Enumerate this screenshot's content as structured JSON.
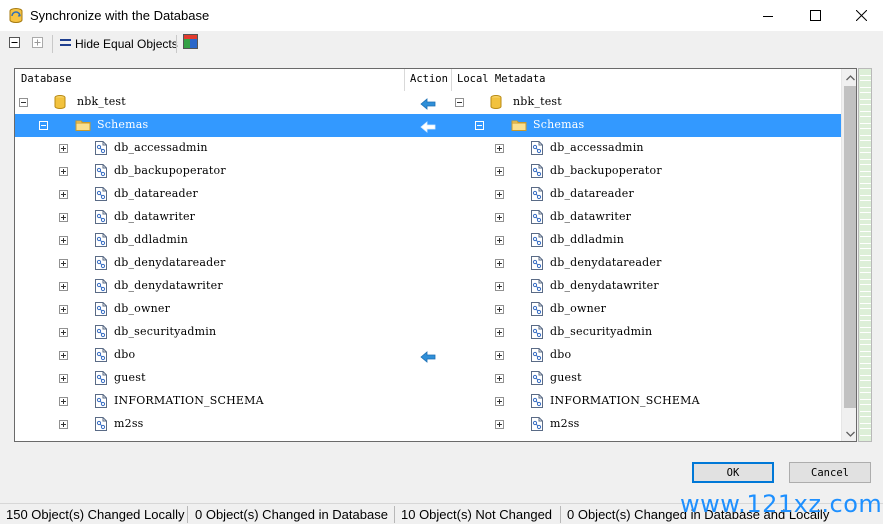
{
  "window": {
    "title": "Synchronize with the Database",
    "app_icon": "sync-db-icon",
    "controls": [
      "minimize-icon",
      "maximize-icon",
      "close-icon"
    ]
  },
  "toolbar": {
    "items": [
      {
        "icon": "collapse-all-icon"
      },
      {
        "icon": "expand-all-icon"
      },
      {
        "icon": "hide-equal-icon",
        "label": "Hide Equal Objects"
      },
      {
        "icon": "color-legend-icon"
      }
    ]
  },
  "grid": {
    "columns": {
      "database": "Database",
      "action": "Action",
      "local": "Local Metadata"
    },
    "rows": [
      {
        "name": "nbk_test",
        "level": 0,
        "expander": "minus",
        "icon": "database-icon",
        "action": "arrow-left",
        "selected": false
      },
      {
        "name": "Schemas",
        "level": 1,
        "expander": "minus",
        "icon": "folder-icon",
        "action": "arrow-left",
        "selected": true
      },
      {
        "name": "db_accessadmin",
        "level": 2,
        "expander": "plus",
        "icon": "schema-icon",
        "action": "",
        "selected": false
      },
      {
        "name": "db_backupoperator",
        "level": 2,
        "expander": "plus",
        "icon": "schema-icon",
        "action": "",
        "selected": false
      },
      {
        "name": "db_datareader",
        "level": 2,
        "expander": "plus",
        "icon": "schema-icon",
        "action": "",
        "selected": false
      },
      {
        "name": "db_datawriter",
        "level": 2,
        "expander": "plus",
        "icon": "schema-icon",
        "action": "",
        "selected": false
      },
      {
        "name": "db_ddladmin",
        "level": 2,
        "expander": "plus",
        "icon": "schema-icon",
        "action": "",
        "selected": false
      },
      {
        "name": "db_denydatareader",
        "level": 2,
        "expander": "plus",
        "icon": "schema-icon",
        "action": "",
        "selected": false
      },
      {
        "name": "db_denydatawriter",
        "level": 2,
        "expander": "plus",
        "icon": "schema-icon",
        "action": "",
        "selected": false
      },
      {
        "name": "db_owner",
        "level": 2,
        "expander": "plus",
        "icon": "schema-icon",
        "action": "",
        "selected": false
      },
      {
        "name": "db_securityadmin",
        "level": 2,
        "expander": "plus",
        "icon": "schema-icon",
        "action": "",
        "selected": false
      },
      {
        "name": "dbo",
        "level": 2,
        "expander": "plus",
        "icon": "schema-icon",
        "action": "arrow-left",
        "selected": false
      },
      {
        "name": "guest",
        "level": 2,
        "expander": "plus",
        "icon": "schema-icon",
        "action": "",
        "selected": false
      },
      {
        "name": "INFORMATION_SCHEMA",
        "level": 2,
        "expander": "plus",
        "icon": "schema-icon",
        "action": "",
        "selected": false
      },
      {
        "name": "m2ss",
        "level": 2,
        "expander": "plus",
        "icon": "schema-icon",
        "action": "",
        "selected": false
      }
    ]
  },
  "buttons": {
    "ok": "OK",
    "cancel": "Cancel"
  },
  "status": [
    "150 Object(s) Changed Locally",
    "0 Object(s) Changed in Database",
    "10 Object(s) Not Changed",
    "0 Object(s) Changed in Database and Locally"
  ],
  "watermark": "www.121xz.com",
  "colors": {
    "selection": "#3399ff",
    "arrow": "#2f8fd8",
    "overview": "#ddefd8",
    "default_button_border": "#0078d7"
  }
}
